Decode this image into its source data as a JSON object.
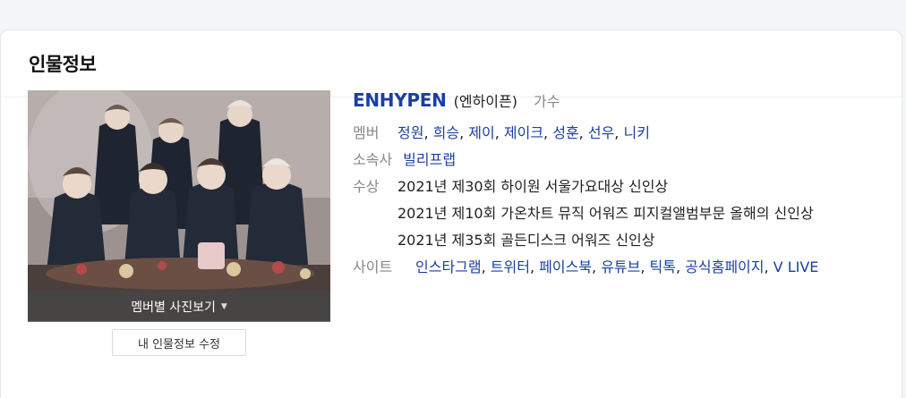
{
  "card": {
    "title": "인물정보"
  },
  "photo": {
    "bar_label": "멤버별 사진보기"
  },
  "edit_label": "내 인물정보 수정",
  "profile": {
    "name": "ENHYPEN",
    "native": "(엔하이픈)",
    "job": "가수",
    "members_label": "멤버",
    "members": [
      "정원",
      "희승",
      "제이",
      "제이크",
      "성훈",
      "선우",
      "니키"
    ],
    "agency_label": "소속사",
    "agency": "빌리프랩",
    "awards_label": "수상",
    "awards": [
      "2021년 제30회 하이원 서울가요대상 신인상",
      "2021년 제10회 가온차트 뮤직 어워즈 피지컬앨범부문 올해의 신인상",
      "2021년 제35회 골든디스크 어워즈 신인상"
    ],
    "sites_label": "사이트",
    "sites": [
      "인스타그램",
      "트위터",
      "페이스북",
      "유튜브",
      "틱톡",
      "공식홈페이지",
      "V LIVE"
    ]
  },
  "colors": {
    "link": "#1a3fa3",
    "label": "#888888"
  }
}
